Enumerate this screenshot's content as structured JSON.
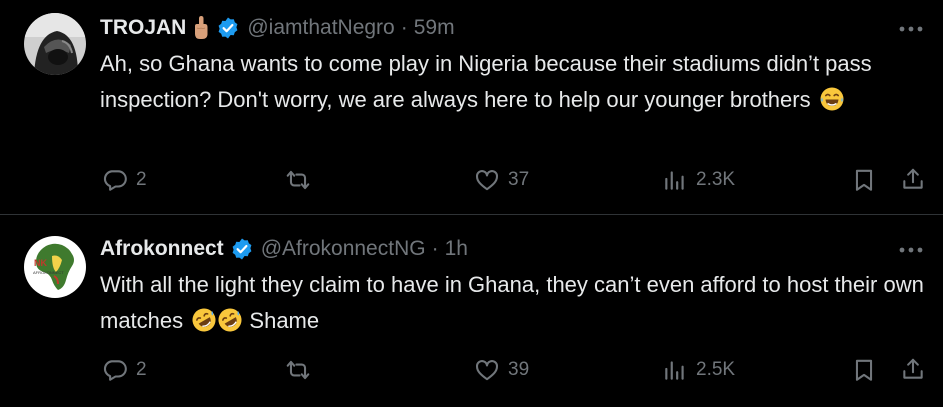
{
  "tweets": [
    {
      "name": "TROJAN",
      "handle": "@iamthatNegro",
      "time": "59m",
      "text": "Ah, so Ghana wants to come play in Nigeria because their stadiums didn’t pass inspection? Don't worry, we are always here to help our younger brothers",
      "replies": "2",
      "likes": "37",
      "views": "2.3K"
    },
    {
      "name": "Afrokonnect",
      "handle": "@AfrokonnectNG",
      "time": "1h",
      "text": "With all the light they claim to have in Ghana, they can’t even afford to host their own matches",
      "text_suffix": "Shame",
      "replies": "2",
      "likes": "39",
      "views": "2.5K"
    }
  ],
  "icons": {
    "reply": "reply-icon",
    "retweet": "retweet-icon",
    "like": "heart-icon",
    "views": "views-icon",
    "bookmark": "bookmark-icon",
    "share": "share-icon",
    "verified": "verified-badge-icon",
    "more": "more-options-icon"
  },
  "colors": {
    "background": "#000000",
    "text": "#e7e9ea",
    "muted": "#71767b",
    "verified": "#1d9bf0",
    "divider": "#2f3336"
  }
}
